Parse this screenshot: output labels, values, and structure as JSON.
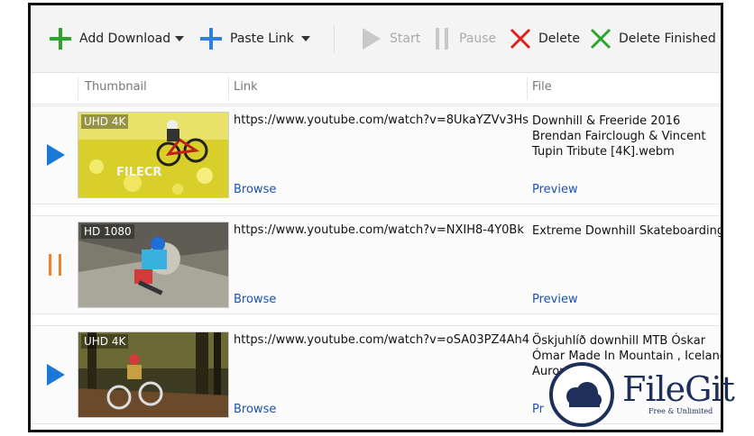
{
  "toolbar": {
    "add_download": "Add Download",
    "paste_link": "Paste Link",
    "start": "Start",
    "pause": "Pause",
    "delete": "Delete",
    "delete_finished": "Delete Finished"
  },
  "columns": {
    "thumbnail": "Thumbnail",
    "link": "Link",
    "file": "File"
  },
  "rows": [
    {
      "status": "queued",
      "badge": "UHD 4K",
      "link": "https://www.youtube.com/watch?v=8UkaYZVv3Hs",
      "file": "Downhill & Freeride 2016  Brendan Fairclough & Vincent Tupin Tribute [4K].webm",
      "browse": "Browse",
      "preview": "Preview",
      "thumb_logo": "FILECR"
    },
    {
      "status": "paused",
      "badge": "HD 1080",
      "link": "https://www.youtube.com/watch?v=NXIH8-4Y0Bk",
      "file": "Extreme Downhill Skateboarding!.m",
      "browse": "Browse",
      "preview": "Preview"
    },
    {
      "status": "queued",
      "badge": "UHD 4K",
      "link": "https://www.youtube.com/watch?v=oSA03PZ4Ah4",
      "file": "Öskjuhlíð downhill MTB Óskar Ómar Made In Mountain , Iceland Aurora Fil",
      "browse": "Browse",
      "preview": "Pr"
    }
  ],
  "watermark": {
    "name": "FileGit",
    "tagline": "Free & Unlimited"
  },
  "colors": {
    "accent_green": "#2aa52a",
    "accent_blue": "#2f7fe0",
    "delete_red": "#e0201c",
    "play_blue": "#1a79d6",
    "pause_orange": "#f0832a",
    "link_blue": "#1a52b8"
  }
}
